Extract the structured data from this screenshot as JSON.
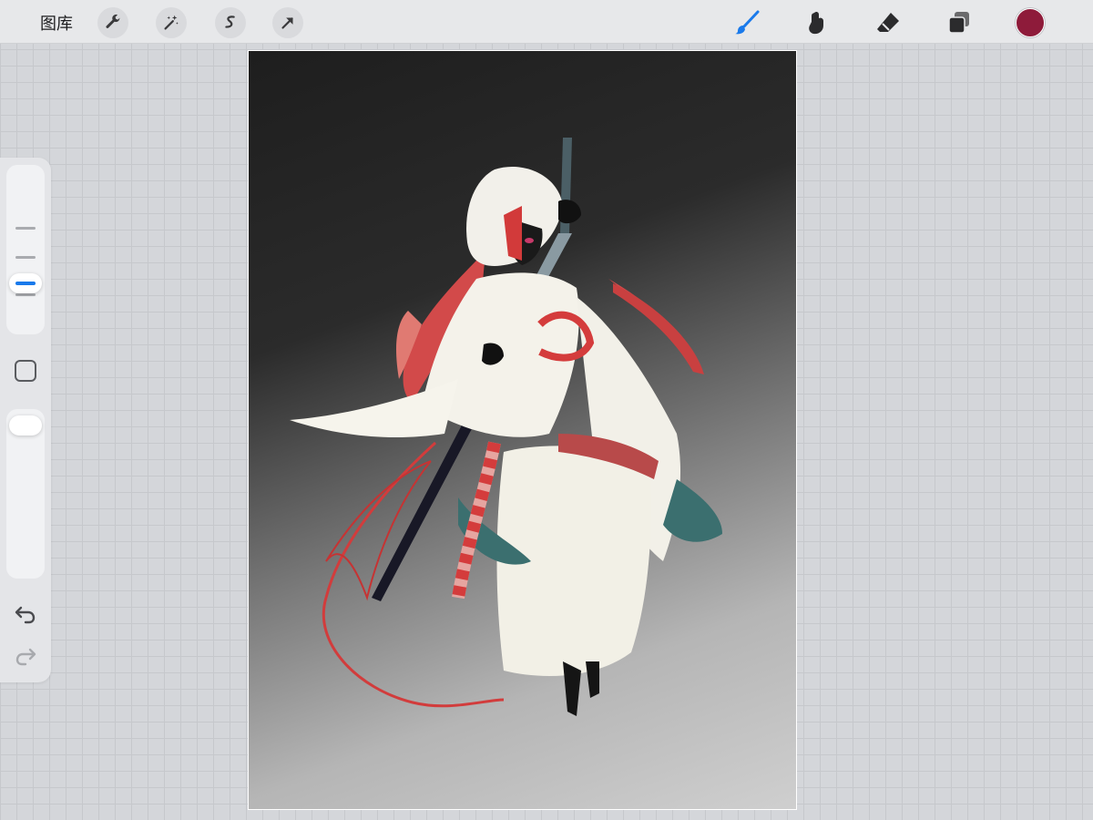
{
  "toolbar": {
    "gallery_label": "图库",
    "actions": [
      {
        "name": "actions-icon",
        "icon": "wrench"
      },
      {
        "name": "adjustments-icon",
        "icon": "magic-wand"
      },
      {
        "name": "selection-icon",
        "icon": "s-selection"
      },
      {
        "name": "transform-icon",
        "icon": "arrow-cursor"
      }
    ],
    "tools": [
      {
        "name": "brush-tool",
        "icon": "brush-icon",
        "active": true
      },
      {
        "name": "smudge-tool",
        "icon": "smudge-icon",
        "active": false
      },
      {
        "name": "eraser-tool",
        "icon": "eraser-icon",
        "active": false
      },
      {
        "name": "layers-tool",
        "icon": "layers-icon",
        "active": false
      }
    ],
    "current_color": "#8e1b3a"
  },
  "sidebar": {
    "brush_size_level": 0.62,
    "opacity_level": 1.0
  },
  "colors": {
    "accent": "#1a7aeb",
    "current_color": "#8e1b3a"
  }
}
